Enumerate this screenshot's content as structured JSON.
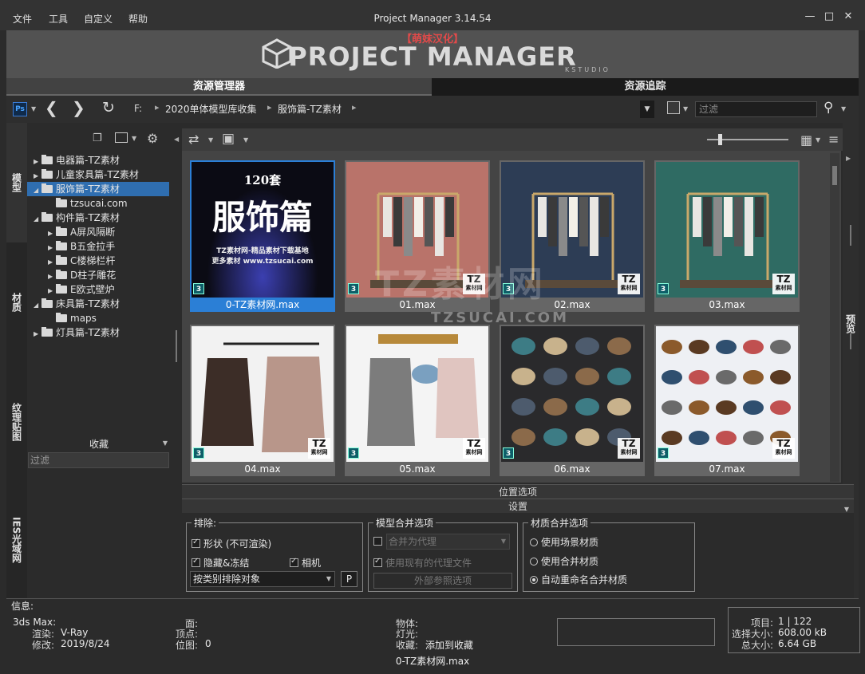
{
  "menu": [
    "文件",
    "工具",
    "自定义",
    "帮助"
  ],
  "app_title": "Project Manager 3.14.54",
  "banner": {
    "subtitle": "【萌妹汉化】",
    "logo_text": "PROJECT MANAGER",
    "studio": "KSTUDIO"
  },
  "tabs": {
    "asset_manager": "资源管理器",
    "asset_tracking": "资源追踪"
  },
  "toolbar": {
    "ps_label": "Ps",
    "drive": "F:",
    "breadcrumbs": [
      "2020单体模型库收集",
      "服饰篇-TZ素材"
    ],
    "filter_placeholder": "过滤"
  },
  "vtabs": [
    "模型",
    "材质",
    "纹理贴图",
    "IES光域网"
  ],
  "right_tab": "预览",
  "tree": [
    {
      "label": "电器篇-TZ素材",
      "level": 0,
      "expanded": false,
      "selected": false
    },
    {
      "label": "儿童家具篇-TZ素材",
      "level": 0,
      "expanded": false,
      "selected": false
    },
    {
      "label": "服饰篇-TZ素材",
      "level": 0,
      "expanded": true,
      "selected": true
    },
    {
      "label": "tzsucai.com",
      "level": 1,
      "expanded": false,
      "selected": false,
      "leaf": true
    },
    {
      "label": "构件篇-TZ素材",
      "level": 0,
      "expanded": true,
      "selected": false
    },
    {
      "label": "A屏风隔断",
      "level": 1,
      "expanded": false,
      "selected": false
    },
    {
      "label": "B五金拉手",
      "level": 1,
      "expanded": false,
      "selected": false
    },
    {
      "label": "C楼梯栏杆",
      "level": 1,
      "expanded": false,
      "selected": false
    },
    {
      "label": "D柱子雕花",
      "level": 1,
      "expanded": false,
      "selected": false
    },
    {
      "label": "E欧式壁炉",
      "level": 1,
      "expanded": false,
      "selected": false
    },
    {
      "label": "床具篇-TZ素材",
      "level": 0,
      "expanded": true,
      "selected": false
    },
    {
      "label": "maps",
      "level": 1,
      "expanded": false,
      "selected": false,
      "leaf": true
    },
    {
      "label": "灯具篇-TZ素材",
      "level": 0,
      "expanded": false,
      "selected": false
    }
  ],
  "favorites": {
    "header": "收藏",
    "filter_placeholder": "过滤"
  },
  "tiles": [
    {
      "label": "0-TZ素材网.max",
      "selected": true,
      "cover_count": "120套",
      "cover_title": "服饰篇",
      "cover_line1": "TZ素材网-精品素材下载基地",
      "cover_line2": "更多素材 www.tzsucai.com"
    },
    {
      "label": "01.max",
      "selected": false,
      "bg": "#b9736a"
    },
    {
      "label": "02.max",
      "selected": false,
      "bg": "#2d3d55"
    },
    {
      "label": "03.max",
      "selected": false,
      "bg": "#2f6b63"
    },
    {
      "label": "04.max",
      "selected": false,
      "bg": "#f2f2f2"
    },
    {
      "label": "05.max",
      "selected": false,
      "bg": "#f4f4f4"
    },
    {
      "label": "06.max",
      "selected": false,
      "bg": "#2a2a2c"
    },
    {
      "label": "07.max",
      "selected": false,
      "bg": "#eef0f4"
    }
  ],
  "tz_badge": {
    "big": "TZ",
    "small": "素材网"
  },
  "max_badge": "3",
  "watermark": {
    "text": "TZ素材网",
    "url": "TZSUCAI.COM"
  },
  "sections": {
    "position_options": "位置选项",
    "settings": "设置"
  },
  "exclude": {
    "title": "排除:",
    "shape": "形状 (不可渲染)",
    "hidden_frozen": "隐藏&冻结",
    "camera": "相机",
    "by_category": "按类别排除对象",
    "p_button": "P"
  },
  "model_merge": {
    "title": "模型合并选项",
    "merge_as_proxy": "合并为代理",
    "use_existing_proxy": "使用现有的代理文件",
    "xref_options": "外部参照选项"
  },
  "material_merge": {
    "title": "材质合并选项",
    "use_scene": "使用场景材质",
    "use_merged": "使用合并材质",
    "auto_rename": "自动重命名合并材质"
  },
  "info": {
    "header": "信息:",
    "app_label": "3ds Max:",
    "render_label": "渲染:",
    "render_value": "V-Ray",
    "modified_label": "修改:",
    "modified_value": "2019/8/24",
    "faces_label": "面:",
    "faces_value": "",
    "verts_label": "顶点:",
    "verts_value": "",
    "bitmaps_label": "位图:",
    "bitmaps_value": "0",
    "objects_label": "物体:",
    "objects_value": "",
    "lights_label": "灯光:",
    "lights_value": "",
    "fav_label": "收藏:",
    "fav_value": "添加到收藏"
  },
  "stats": {
    "items_label": "项目:",
    "items_value": "1 | 122",
    "sel_size_label": "选择大小:",
    "sel_size_value": "608.00 kB",
    "total_label": "总大小:",
    "total_value": "6.64 GB"
  },
  "status_file": "0-TZ素材网.max",
  "colors": {
    "selection": "#2f6eb0",
    "tile_selected": "#2b7fd6",
    "banner_red": "#e24a4a"
  }
}
